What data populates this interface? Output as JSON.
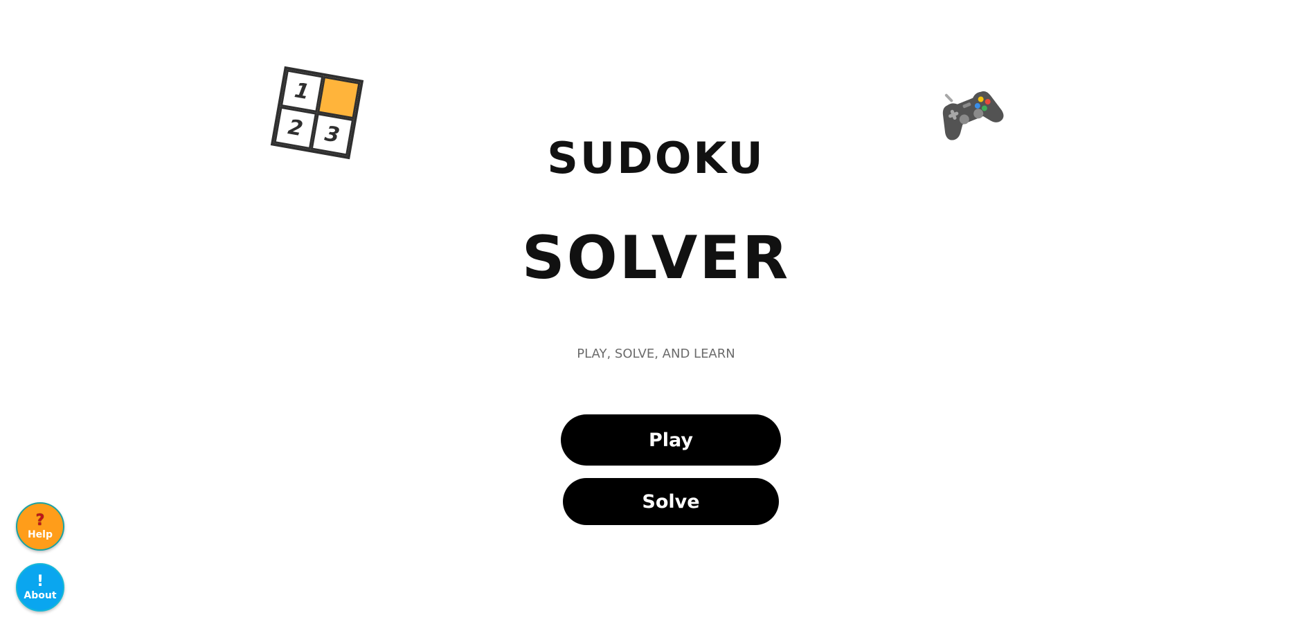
{
  "header": {
    "sudoku_icon": {
      "icon": "sudoku-grid-icon",
      "cells": [
        "1",
        "",
        "2",
        "3"
      ],
      "accent": "#ffb43b"
    },
    "gamepad_icon": {
      "icon": "gamepad-icon",
      "color": "#4f4f4f"
    }
  },
  "main": {
    "title_line1": "SUDOKU",
    "title_line2": "SOLVER",
    "tagline": "PLAY, SOLVE, AND LEARN",
    "play_label": "Play",
    "solve_label": "Solve"
  },
  "floating": {
    "help": {
      "glyph": "?",
      "label": "Help",
      "color": "#ff9d1a"
    },
    "about": {
      "glyph": "!",
      "label": "About",
      "color": "#0aa6ef"
    }
  }
}
